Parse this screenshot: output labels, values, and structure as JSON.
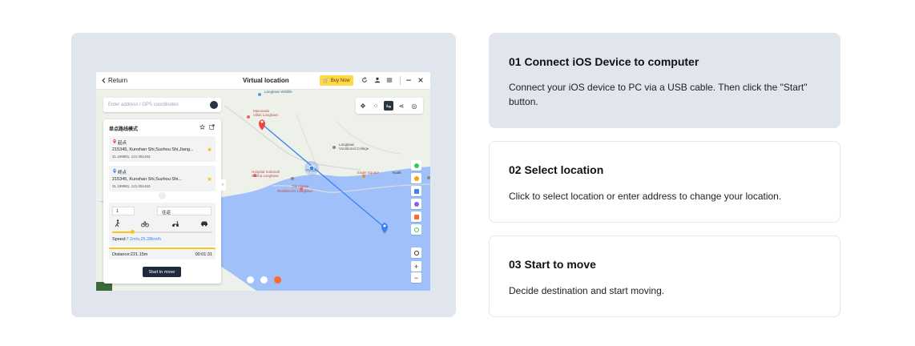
{
  "app": {
    "return_label": "Return",
    "title": "Virtual location",
    "buy_label": "Buy Now",
    "search_placeholder": "Enter address / GPS coordinates",
    "route_panel": {
      "title": "单点路线模式",
      "start": {
        "label": "起点",
        "address": "215345,  Kunshan Shi,Suzhou Shi,Jiang...",
        "coords": "31.199881, 121.051463"
      },
      "end": {
        "label": "终点",
        "address": "215345,  Kunshan Shi,Suzhou Shi...",
        "coords": "31.199881, 121.051463"
      },
      "count_value": "1",
      "mode_value": "往返",
      "speed_label": "Speed:",
      "speed_value": "7.2m/s,25.28km/h",
      "distance": "Distance:221.15m",
      "duration": "00:01:31",
      "start_button": "Start to move"
    },
    "map_labels": {
      "langkawi_wildlife": "Langkawi Wildlife",
      "marcanda": "Marcanda",
      "villas": "Villas Langkawi",
      "langkawi_college": "Langkawi",
      "vocational": "Vocational College",
      "hospital": "Hospital Sultanah",
      "maliha": "Maliha Langkawi",
      "tile_house": "Tile House",
      "residences": "Residences Langkawi",
      "eagle": "Eagle Square",
      "kuah": "Kuah",
      "pa": "Pantai"
    }
  },
  "steps": [
    {
      "title": "01 Connect iOS Device to computer",
      "desc": "Connect your iOS device to PC via a USB cable. Then click the \"Start\" button."
    },
    {
      "title": "02 Select location",
      "desc": "Click to select location or enter address to change your location."
    },
    {
      "title": "03 Start to move",
      "desc": "Decide destination and start moving."
    }
  ],
  "colors": {
    "accent_orange": "#ff6a2b",
    "route_blue": "#3b82f6",
    "buy_yellow": "#ffd84a",
    "panel_gray": "#e1e5ee"
  }
}
